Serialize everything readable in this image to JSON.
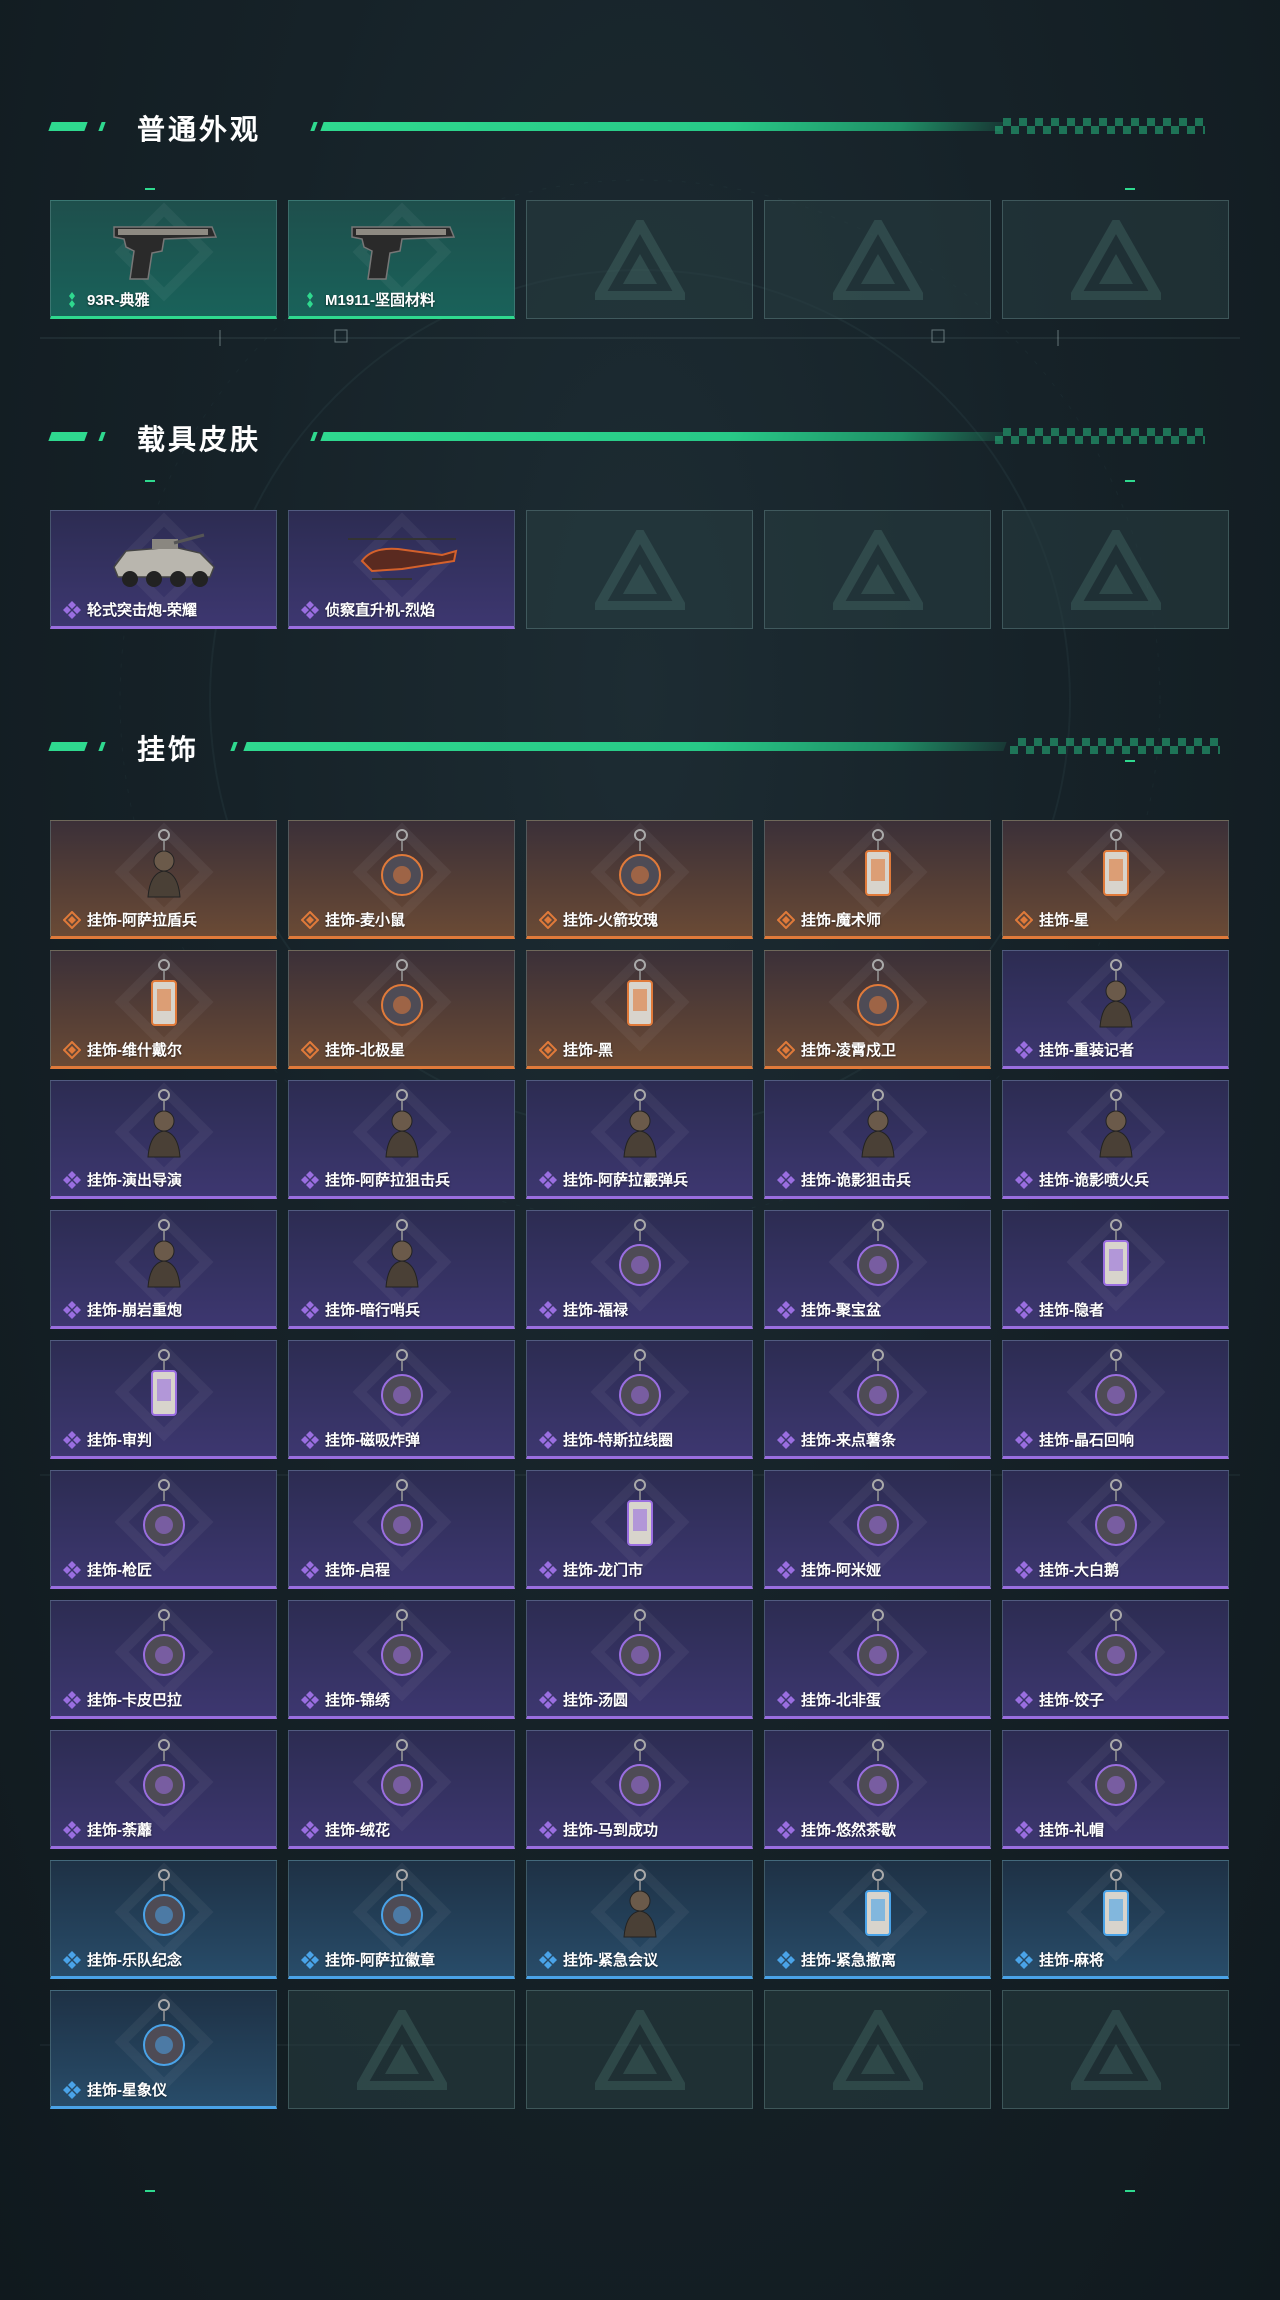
{
  "sections": [
    {
      "title": "普通外观",
      "items": [
        {
          "label": "93R-典雅",
          "rarity": "green",
          "icon": "pistol-icon"
        },
        {
          "label": "M1911-坚固材料",
          "rarity": "green",
          "icon": "pistol-icon"
        },
        {
          "label": "",
          "rarity": "empty"
        },
        {
          "label": "",
          "rarity": "empty"
        },
        {
          "label": "",
          "rarity": "empty"
        }
      ]
    },
    {
      "title": "载具皮肤",
      "items": [
        {
          "label": "轮式突击炮-荣耀",
          "rarity": "purple",
          "icon": "armored-vehicle-icon"
        },
        {
          "label": "侦察直升机-烈焰",
          "rarity": "purple",
          "icon": "helicopter-icon"
        },
        {
          "label": "",
          "rarity": "empty"
        },
        {
          "label": "",
          "rarity": "empty"
        },
        {
          "label": "",
          "rarity": "empty"
        }
      ]
    },
    {
      "title": "挂饰",
      "items": [
        {
          "label": "挂饰-阿萨拉盾兵",
          "rarity": "orange",
          "icon": "soldier-charm-icon"
        },
        {
          "label": "挂饰-麦小鼠",
          "rarity": "orange",
          "icon": "mouse-charm-icon"
        },
        {
          "label": "挂饰-火箭玫瑰",
          "rarity": "orange",
          "icon": "rocket-charm-icon"
        },
        {
          "label": "挂饰-魔术师",
          "rarity": "orange",
          "icon": "card-charm-icon"
        },
        {
          "label": "挂饰-星",
          "rarity": "orange",
          "icon": "card-charm-icon"
        },
        {
          "label": "挂饰-维什戴尔",
          "rarity": "orange",
          "icon": "tag-charm-icon"
        },
        {
          "label": "挂饰-北极星",
          "rarity": "orange",
          "icon": "star-charm-icon"
        },
        {
          "label": "挂饰-黑",
          "rarity": "orange",
          "icon": "tag-charm-icon"
        },
        {
          "label": "挂饰-凌霄戍卫",
          "rarity": "orange",
          "icon": "bird-charm-icon"
        },
        {
          "label": "挂饰-重装记者",
          "rarity": "purple",
          "icon": "figure-charm-icon"
        },
        {
          "label": "挂饰-演出导演",
          "rarity": "purple",
          "icon": "figure-charm-icon"
        },
        {
          "label": "挂饰-阿萨拉狙击兵",
          "rarity": "purple",
          "icon": "soldier-charm-icon"
        },
        {
          "label": "挂饰-阿萨拉霰弹兵",
          "rarity": "purple",
          "icon": "soldier-charm-icon"
        },
        {
          "label": "挂饰-诡影狙击兵",
          "rarity": "purple",
          "icon": "figure-charm-icon"
        },
        {
          "label": "挂饰-诡影喷火兵",
          "rarity": "purple",
          "icon": "figure-charm-icon"
        },
        {
          "label": "挂饰-崩岩重炮",
          "rarity": "purple",
          "icon": "figure-charm-icon"
        },
        {
          "label": "挂饰-暗行哨兵",
          "rarity": "purple",
          "icon": "figure-charm-icon"
        },
        {
          "label": "挂饰-福禄",
          "rarity": "purple",
          "icon": "gourd-charm-icon"
        },
        {
          "label": "挂饰-聚宝盆",
          "rarity": "purple",
          "icon": "treasure-bowl-charm-icon"
        },
        {
          "label": "挂饰-隐者",
          "rarity": "purple",
          "icon": "card-charm-icon"
        },
        {
          "label": "挂饰-审判",
          "rarity": "purple",
          "icon": "card-charm-icon"
        },
        {
          "label": "挂饰-磁吸炸弹",
          "rarity": "purple",
          "icon": "bomb-charm-icon"
        },
        {
          "label": "挂饰-特斯拉线圈",
          "rarity": "purple",
          "icon": "coil-charm-icon"
        },
        {
          "label": "挂饰-来点薯条",
          "rarity": "purple",
          "icon": "fries-charm-icon"
        },
        {
          "label": "挂饰-晶石回响",
          "rarity": "purple",
          "icon": "crystal-charm-icon"
        },
        {
          "label": "挂饰-枪匠",
          "rarity": "purple",
          "icon": "gun-charm-icon"
        },
        {
          "label": "挂饰-启程",
          "rarity": "purple",
          "icon": "compass-charm-icon"
        },
        {
          "label": "挂饰-龙门市",
          "rarity": "purple",
          "icon": "phone-charm-icon"
        },
        {
          "label": "挂饰-阿米娅",
          "rarity": "purple",
          "icon": "bunny-charm-icon"
        },
        {
          "label": "挂饰-大白鹅",
          "rarity": "purple",
          "icon": "goose-charm-icon"
        },
        {
          "label": "挂饰-卡皮巴拉",
          "rarity": "purple",
          "icon": "capybara-charm-icon"
        },
        {
          "label": "挂饰-锦绣",
          "rarity": "purple",
          "icon": "butterfly-charm-icon"
        },
        {
          "label": "挂饰-汤圆",
          "rarity": "purple",
          "icon": "dumpling-charm-icon"
        },
        {
          "label": "挂饰-北非蛋",
          "rarity": "purple",
          "icon": "food-charm-icon"
        },
        {
          "label": "挂饰-饺子",
          "rarity": "purple",
          "icon": "food-charm-icon"
        },
        {
          "label": "挂饰-荼蘼",
          "rarity": "purple",
          "icon": "flower-charm-icon"
        },
        {
          "label": "挂饰-绒花",
          "rarity": "purple",
          "icon": "flower-charm-icon"
        },
        {
          "label": "挂饰-马到成功",
          "rarity": "purple",
          "icon": "horse-charm-icon"
        },
        {
          "label": "挂饰-悠然茶歇",
          "rarity": "purple",
          "icon": "cupcake-charm-icon"
        },
        {
          "label": "挂饰-礼帽",
          "rarity": "purple",
          "icon": "hat-charm-icon"
        },
        {
          "label": "挂饰-乐队纪念",
          "rarity": "blue",
          "icon": "badge-charm-icon"
        },
        {
          "label": "挂饰-阿萨拉徽章",
          "rarity": "blue",
          "icon": "badge-charm-icon"
        },
        {
          "label": "挂饰-紧急会议",
          "rarity": "blue",
          "icon": "figure-charm-icon"
        },
        {
          "label": "挂饰-紧急撤离",
          "rarity": "blue",
          "icon": "tag-charm-icon"
        },
        {
          "label": "挂饰-麻将",
          "rarity": "blue",
          "icon": "mahjong-charm-icon"
        },
        {
          "label": "挂饰-星象仪",
          "rarity": "blue",
          "icon": "astrolabe-charm-icon"
        },
        {
          "label": "",
          "rarity": "empty"
        },
        {
          "label": "",
          "rarity": "empty"
        },
        {
          "label": "",
          "rarity": "empty"
        },
        {
          "label": "",
          "rarity": "empty"
        }
      ]
    }
  ],
  "colors": {
    "accent": "#2fd98f",
    "green": "#2fd98f",
    "purple": "#9a6ee0",
    "orange": "#e07a3a",
    "blue": "#4aa3e8"
  }
}
